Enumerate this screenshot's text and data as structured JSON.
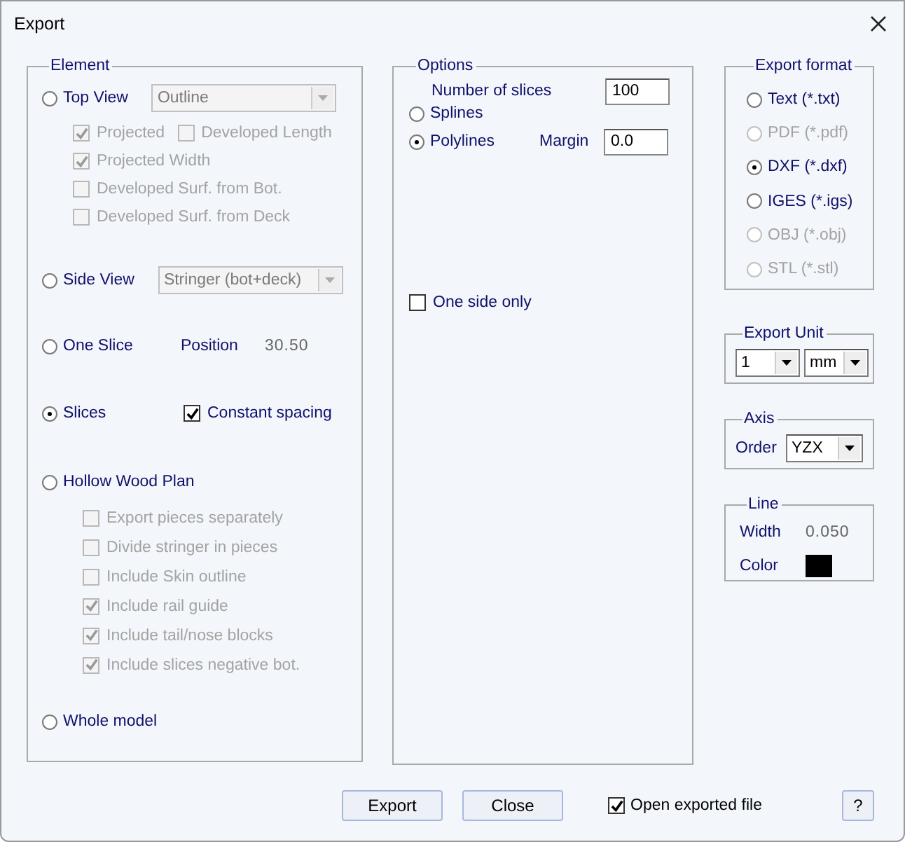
{
  "window": {
    "title": "Export"
  },
  "element": {
    "title": "Element",
    "top_view": {
      "label": "Top View",
      "selected": false,
      "dropdown": {
        "value": "Outline",
        "disabled": true
      },
      "rows": [
        {
          "items": [
            {
              "label": "Projected",
              "checked": true,
              "disabled": true
            },
            {
              "label": "Developed Length",
              "checked": false,
              "disabled": true
            }
          ]
        },
        {
          "items": [
            {
              "label": "Projected Width",
              "checked": true,
              "disabled": true
            }
          ]
        },
        {
          "items": [
            {
              "label": "Developed Surf. from Bot.",
              "checked": false,
              "disabled": true
            }
          ]
        },
        {
          "items": [
            {
              "label": "Developed Surf. from Deck",
              "checked": false,
              "disabled": true
            }
          ]
        }
      ]
    },
    "side_view": {
      "label": "Side View",
      "selected": false,
      "dropdown": {
        "value": "Stringer (bot+deck)",
        "disabled": true
      }
    },
    "one_slice": {
      "label": "One Slice",
      "selected": false,
      "position_label": "Position",
      "position_value": "30.50"
    },
    "slices": {
      "label": "Slices",
      "selected": true,
      "constant_spacing": {
        "label": "Constant spacing",
        "checked": true,
        "disabled": false
      }
    },
    "hollow_wood_plan": {
      "label": "Hollow Wood Plan",
      "selected": false,
      "options": [
        {
          "label": "Export pieces separately",
          "checked": false,
          "disabled": true
        },
        {
          "label": "Divide stringer in pieces",
          "checked": false,
          "disabled": true
        },
        {
          "label": "Include Skin outline",
          "checked": false,
          "disabled": true
        },
        {
          "label": "Include rail guide",
          "checked": true,
          "disabled": true
        },
        {
          "label": "Include tail/nose blocks",
          "checked": true,
          "disabled": true
        },
        {
          "label": "Include slices negative bot.",
          "checked": true,
          "disabled": true
        }
      ]
    },
    "whole_model": {
      "label": "Whole model",
      "selected": false
    }
  },
  "options": {
    "title": "Options",
    "number_of_slices": {
      "label": "Number of slices",
      "value": "100"
    },
    "curves": [
      {
        "label": "Splines",
        "selected": false
      },
      {
        "label": "Polylines",
        "selected": true
      }
    ],
    "margin": {
      "label": "Margin",
      "value": "0.0"
    },
    "one_side_only": {
      "label": "One side only",
      "checked": false,
      "disabled": false
    }
  },
  "export_format": {
    "title": "Export format",
    "formats": [
      {
        "label": "Text (*.txt)",
        "selected": false,
        "disabled": false
      },
      {
        "label": "PDF (*.pdf)",
        "selected": false,
        "disabled": true
      },
      {
        "label": "DXF (*.dxf)",
        "selected": true,
        "disabled": false
      },
      {
        "label": "IGES (*.igs)",
        "selected": false,
        "disabled": false
      },
      {
        "label": "OBJ (*.obj)",
        "selected": false,
        "disabled": true
      },
      {
        "label": "STL (*.stl)",
        "selected": false,
        "disabled": true
      }
    ]
  },
  "export_unit": {
    "title": "Export Unit",
    "scale": "1",
    "unit": "mm"
  },
  "axis": {
    "title": "Axis",
    "order_label": "Order",
    "order": "YZX"
  },
  "line": {
    "title": "Line",
    "width_label": "Width",
    "width_value": "0.050",
    "color_label": "Color",
    "color": "#000000"
  },
  "buttons": {
    "export": "Export",
    "close": "Close",
    "help": "?"
  },
  "open_exported_file": {
    "label": "Open exported file",
    "checked": true,
    "disabled": false
  }
}
